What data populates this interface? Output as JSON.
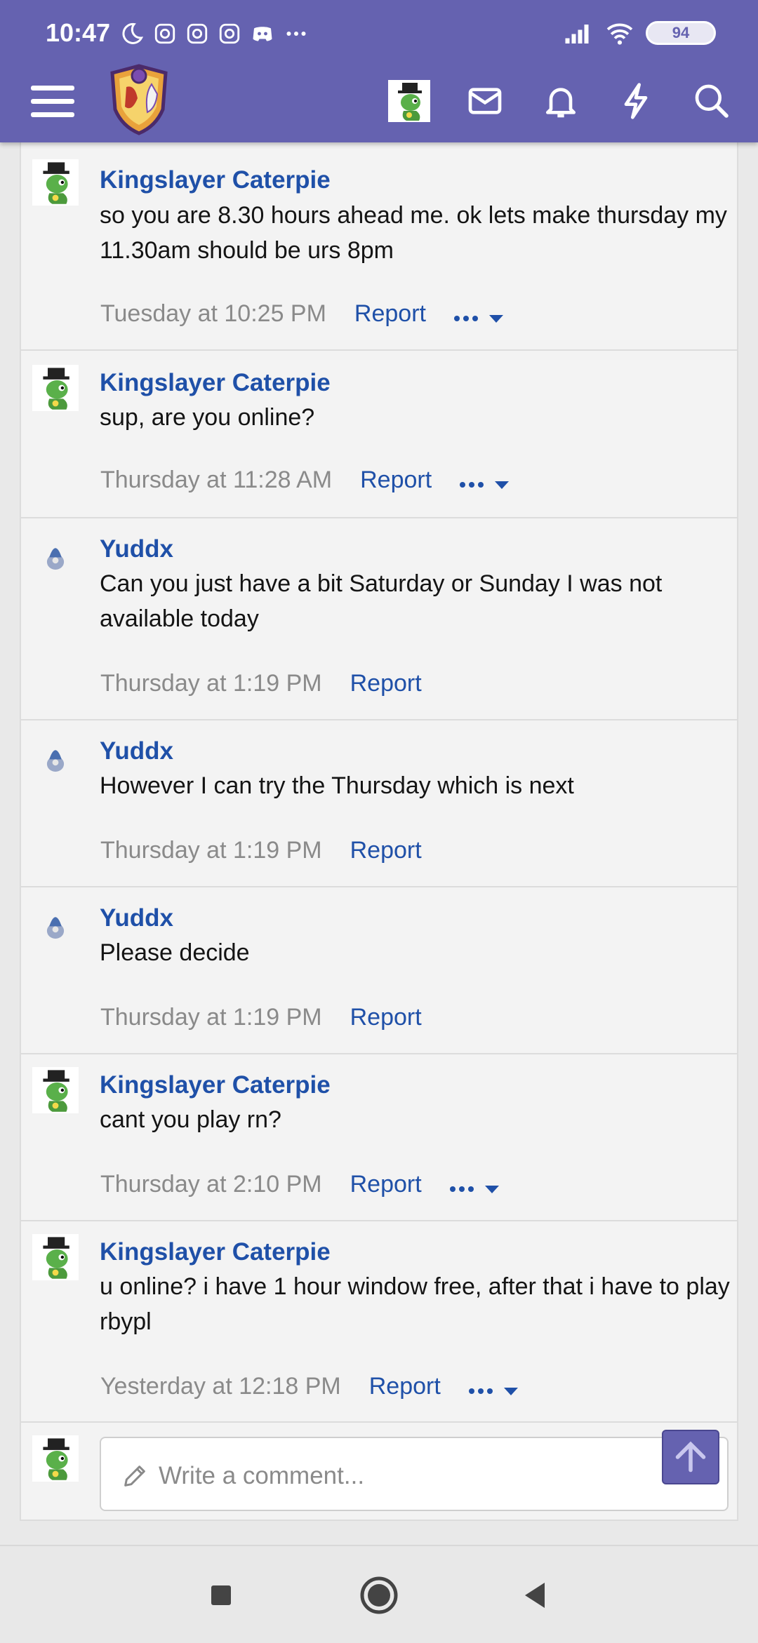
{
  "status_bar": {
    "time": "10:47",
    "battery": "94"
  },
  "composer": {
    "placeholder": "Write a comment..."
  },
  "messages": [
    {
      "author": "Kingslayer Caterpie",
      "text": "so you are 8.30 hours ahead me. ok lets make thursday my 11.30am should be urs 8pm",
      "time": "Tuesday at 10:25 PM",
      "report": "Report"
    },
    {
      "author": "Kingslayer Caterpie",
      "text": "sup, are you online?",
      "time": "Thursday at 11:28 AM",
      "report": "Report"
    },
    {
      "author": "Yuddx",
      "text": "Can you just have a bit Saturday or Sunday I was not available today",
      "time": "Thursday at 1:19 PM",
      "report": "Report"
    },
    {
      "author": "Yuddx",
      "text": "However I can try the Thursday which is next",
      "time": "Thursday at 1:19 PM",
      "report": "Report"
    },
    {
      "author": "Yuddx",
      "text": "Please decide",
      "time": "Thursday at 1:19 PM",
      "report": "Report"
    },
    {
      "author": "Kingslayer Caterpie",
      "text": "cant you play rn?",
      "time": "Thursday at 2:10 PM",
      "report": "Report"
    },
    {
      "author": "Kingslayer Caterpie",
      "text": "u online? i have 1 hour window free, after that i have to play rbypl",
      "time": "Yesterday at 12:18 PM",
      "report": "Report"
    }
  ],
  "icons": {
    "menu": "hamburger-menu-icon",
    "inbox": "envelope-icon",
    "alerts": "bell-icon",
    "whats_new": "lightning-icon",
    "search": "search-icon"
  },
  "colors": {
    "header": "#6562b0",
    "link": "#1f50a8"
  }
}
